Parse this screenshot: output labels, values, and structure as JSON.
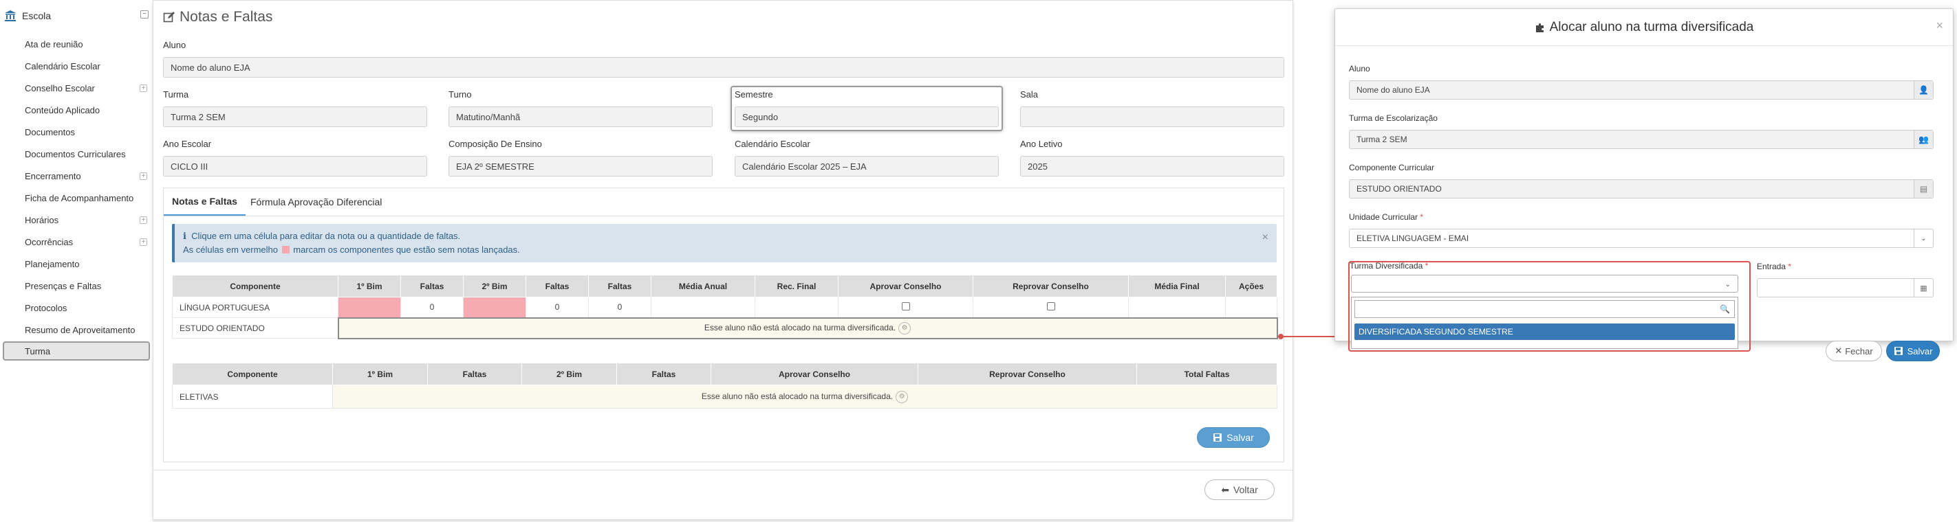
{
  "sidebar": {
    "header": "Escola",
    "items": [
      {
        "label": "Ata de reunião",
        "expandable": false
      },
      {
        "label": "Calendário Escolar",
        "expandable": false
      },
      {
        "label": "Conselho Escolar",
        "expandable": true
      },
      {
        "label": "Conteúdo Aplicado",
        "expandable": false
      },
      {
        "label": "Documentos",
        "expandable": false
      },
      {
        "label": "Documentos Curriculares",
        "expandable": false
      },
      {
        "label": "Encerramento",
        "expandable": true
      },
      {
        "label": "Ficha de Acompanhamento",
        "expandable": false
      },
      {
        "label": "Horários",
        "expandable": true
      },
      {
        "label": "Ocorrências",
        "expandable": true
      },
      {
        "label": "Planejamento",
        "expandable": false
      },
      {
        "label": "Presenças e Faltas",
        "expandable": false
      },
      {
        "label": "Protocolos",
        "expandable": false
      },
      {
        "label": "Resumo de Aproveitamento",
        "expandable": false
      },
      {
        "label": "Turma",
        "expandable": false,
        "active": true
      }
    ]
  },
  "page": {
    "title": "Notas e Faltas",
    "fields": {
      "aluno": {
        "label": "Aluno",
        "value": "Nome do aluno EJA"
      },
      "turma": {
        "label": "Turma",
        "value": "Turma 2 SEM"
      },
      "turno": {
        "label": "Turno",
        "value": "Matutino/Manhã"
      },
      "semestre": {
        "label": "Semestre",
        "value": "Segundo"
      },
      "sala": {
        "label": "Sala",
        "value": ""
      },
      "ano_escolar": {
        "label": "Ano Escolar",
        "value": "CICLO III"
      },
      "composicao": {
        "label": "Composição De Ensino",
        "value": "EJA 2º SEMESTRE"
      },
      "calendario": {
        "label": "Calendário Escolar",
        "value": "Calendário Escolar 2025 – EJA"
      },
      "ano_letivo": {
        "label": "Ano Letivo",
        "value": "2025"
      }
    },
    "tabs": [
      "Notas e Faltas",
      "Fórmula Aprovação Diferencial"
    ],
    "alert": {
      "line1": "Clique em uma célula para editar da nota ou a quantidade de faltas.",
      "line2_pre": "As células em vermelho",
      "line2_post": "marcam os componentes que estão sem notas lançadas."
    },
    "grades_table": {
      "headers": [
        "Componente",
        "1º Bim",
        "Faltas",
        "2º Bim",
        "Faltas",
        "Faltas",
        "Média Anual",
        "Rec. Final",
        "Aprovar Conselho",
        "Reprovar Conselho",
        "Média Final",
        "Ações"
      ],
      "row1": {
        "componente": "LÍNGUA PORTUGUESA",
        "faltas1": "0",
        "faltas2": "0",
        "faltas3": "0"
      },
      "row2": {
        "componente": "ESTUDO ORIENTADO",
        "notice": "Esse aluno não está alocado na turma diversificada."
      }
    },
    "eletivas_table": {
      "headers": [
        "Componente",
        "1º Bim",
        "Faltas",
        "2º Bim",
        "Faltas",
        "Aprovar Conselho",
        "Reprovar Conselho",
        "Total Faltas"
      ],
      "row1": {
        "componente": "ELETIVAS",
        "notice": "Esse aluno não está alocado na turma diversificada."
      }
    },
    "save_label": "Salvar",
    "back_label": "Voltar"
  },
  "modal": {
    "title": "Alocar aluno na turma diversificada",
    "aluno": {
      "label": "Aluno",
      "value": "Nome do aluno EJA"
    },
    "turma_escolarizacao": {
      "label": "Turma de Escolarização",
      "value": "Turma 2 SEM"
    },
    "componente": {
      "label": "Componente Curricular",
      "value": "ESTUDO ORIENTADO"
    },
    "unidade": {
      "label": "Unidade Curricular",
      "value": "ELETIVA LINGUAGEM - EMAI"
    },
    "turma_diversificada": {
      "label": "Turma Diversificada",
      "value": ""
    },
    "entrada": {
      "label": "Entrada",
      "value": ""
    },
    "dropdown_options": [
      "DIVERSIFICADA SEGUNDO SEMESTRE"
    ],
    "close_label": "Fechar",
    "save_label": "Salvar"
  },
  "colors": {
    "accent": "#2f7fc1",
    "missing_grade": "#f7aab2",
    "alert_bg": "#d8e3ed",
    "highlight_red": "#d9534f"
  }
}
